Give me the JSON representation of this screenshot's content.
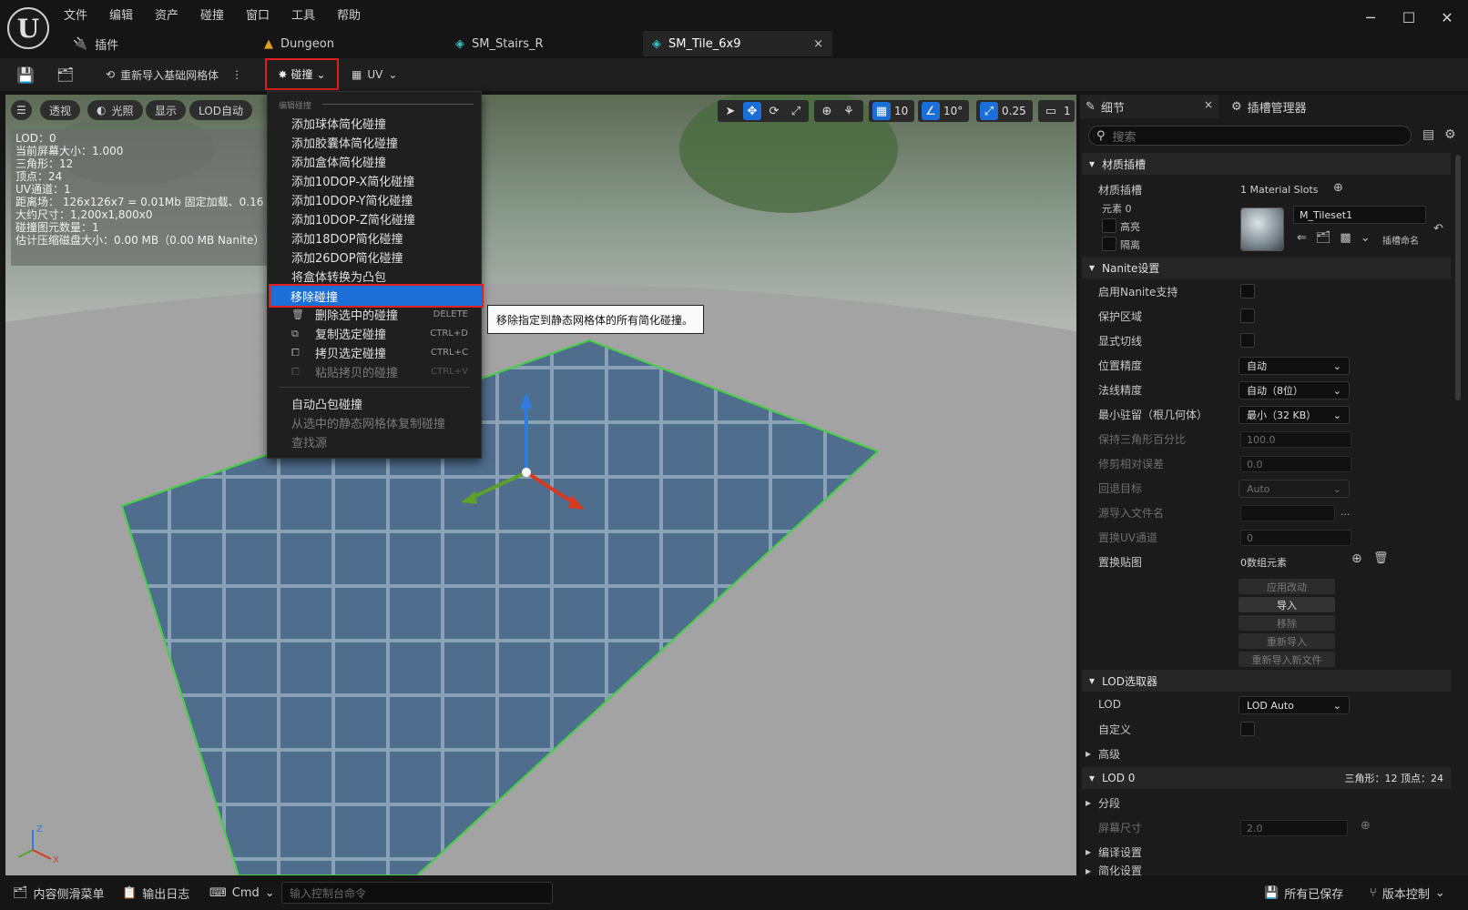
{
  "app": {
    "logo": "U"
  },
  "menu": [
    "文件",
    "编辑",
    "资产",
    "碰撞",
    "窗口",
    "工具",
    "帮助"
  ],
  "tabs": [
    {
      "label": "插件",
      "icon": "plugin-icon"
    },
    {
      "label": "Dungeon",
      "icon": "level-icon"
    },
    {
      "label": "SM_Stairs_R",
      "icon": "static-mesh-icon"
    },
    {
      "label": "SM_Tile_6x9",
      "icon": "static-mesh-icon",
      "active": true,
      "close": "×"
    }
  ],
  "window": {
    "minimize": "─",
    "maximize": "☐",
    "close": "✕"
  },
  "toolbar": {
    "reimport": "重新导入基础网格体",
    "collision": "碰撞",
    "uv": "UV"
  },
  "viewport": {
    "perspective": "透视",
    "lighting": "光照",
    "show": "显示",
    "lod": "LOD自动",
    "grid_value": "10",
    "angle_value": "10°",
    "scale_value": "0.25",
    "camera_value": "1",
    "stats": [
      "LOD：0",
      "当前屏幕大小：1.000",
      "三角形：12",
      "顶点：24",
      "UV通道：1",
      "距离场： 126x126x7 = 0.01Mb 固定加载、0.16M",
      "大约尺寸：1,200x1,800x0",
      "碰撞图元数量：1",
      "估计压缩磁盘大小：0.00 MB（0.00 MB Nanite）"
    ],
    "axis": {
      "z": "Z",
      "x": "X"
    }
  },
  "dropdown": {
    "header": "编辑碰撞",
    "items": [
      "添加球体简化碰撞",
      "添加胶囊体简化碰撞",
      "添加盒体简化碰撞",
      "添加10DOP-X简化碰撞",
      "添加10DOP-Y简化碰撞",
      "添加10DOP-Z简化碰撞",
      "添加18DOP简化碰撞",
      "添加26DOP简化碰撞",
      "将盒体转换为凸包"
    ],
    "remove": "移除碰撞",
    "actions": [
      {
        "label": "删除选中的碰撞",
        "shortcut": "DELETE",
        "dim": false
      },
      {
        "label": "复制选定碰撞",
        "shortcut": "CTRL+D",
        "dim": false
      },
      {
        "label": "拷贝选定碰撞",
        "shortcut": "CTRL+C",
        "dim": false
      },
      {
        "label": "粘贴拷贝的碰撞",
        "shortcut": "CTRL+V",
        "dim": true
      }
    ],
    "extra": [
      "自动凸包碰撞",
      "从选中的静态网格体复制碰撞",
      "查找源"
    ],
    "tooltip": "移除指定到静态网格体的所有简化碰撞。"
  },
  "panel": {
    "tab_details": "细节",
    "tab_slots": "插槽管理器",
    "search_placeholder": "搜索",
    "sec_material": "材质插槽",
    "slots_label": "材质插槽",
    "slots_value": "1 Material Slots",
    "element": "元素 0",
    "highlight": "高亮",
    "isolate": "隔离",
    "material_name": "M_Tileset1",
    "slot_name": "插槽命名",
    "sec_nanite": "Nanite设置",
    "nanite_rows": [
      "启用Nanite支持",
      "保护区域",
      "显式切线"
    ],
    "pos_prec": "位置精度",
    "pos_prec_val": "自动",
    "normal_prec": "法线精度",
    "normal_prec_val": "自动（8位）",
    "min_resident": "最小驻留（根几何体）",
    "min_resident_val": "最小（32 KB）",
    "keep_tri": "保持三角形百分比",
    "keep_tri_val": "100.0",
    "trim_err": "修剪相对误差",
    "trim_err_val": "0.0",
    "fallback": "回退目标",
    "fallback_val": "Auto",
    "src_file": "源导入文件名",
    "src_file_dots": "...",
    "uv_ch": "置换UV通道",
    "uv_ch_val": "0",
    "disp_map": "置换贴图",
    "disp_map_val": "0数组元素",
    "btn_apply": "应用改动",
    "btn_import": "导入",
    "btn_remove": "移除",
    "btn_reimport": "重新导入",
    "btn_reimport_new": "重新导入新文件",
    "sec_lod": "LOD选取器",
    "lod_label": "LOD",
    "lod_val": "LOD Auto",
    "custom": "自定义",
    "advanced": "高级",
    "sec_lod0": "LOD 0",
    "lod0_stats": "三角形：12   顶点：24",
    "sections": "分段",
    "screen_size": "屏幕尺寸",
    "screen_size_val": "2.0",
    "build": "编译设置",
    "reduce": "简化设置"
  },
  "status": {
    "content": "内容侧滑菜单",
    "log": "输出日志",
    "cmd": "Cmd",
    "console_placeholder": "输入控制台命令",
    "saved": "所有已保存",
    "vcs": "版本控制"
  },
  "colors": {
    "accent": "#1b6fd6",
    "highlight_border": "#e02020",
    "tile": "#4f6d8c",
    "gizmo_z": "#2f7be0",
    "gizmo_x": "#d83a1f",
    "gizmo_y": "#5ba12a"
  }
}
